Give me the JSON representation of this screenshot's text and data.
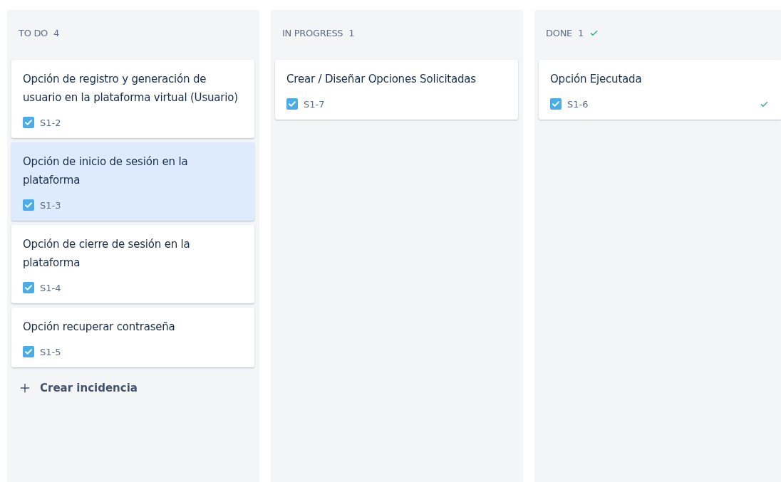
{
  "columns": [
    {
      "title": "TO DO",
      "count": "4",
      "done": false,
      "cards": [
        {
          "summary": "Opción de registro y generación de usuario en la plataforma virtual (Usuario)",
          "key": "S1-2",
          "selected": false,
          "resolved": false
        },
        {
          "summary": "Opción de inicio de sesión en la plataforma",
          "key": "S1-3",
          "selected": true,
          "resolved": false
        },
        {
          "summary": "Opción de cierre de sesión en la plataforma",
          "key": "S1-4",
          "selected": false,
          "resolved": false
        },
        {
          "summary": "Opción recuperar contraseña",
          "key": "S1-5",
          "selected": false,
          "resolved": false
        }
      ],
      "create_label": "Crear incidencia"
    },
    {
      "title": "IN PROGRESS",
      "count": "1",
      "done": false,
      "cards": [
        {
          "summary": "Crear / Diseñar Opciones Solicitadas",
          "key": "S1-7",
          "selected": false,
          "resolved": false
        }
      ]
    },
    {
      "title": "DONE",
      "count": "1",
      "done": true,
      "cards": [
        {
          "summary": "Opción Ejecutada",
          "key": "S1-6",
          "selected": false,
          "resolved": true
        }
      ]
    }
  ]
}
